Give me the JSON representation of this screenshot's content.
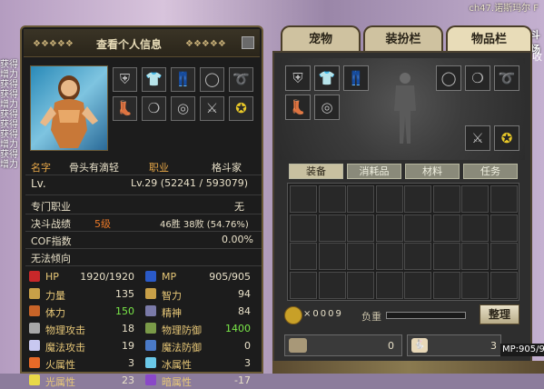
{
  "top": {
    "server_text": "ch47.诺斯玛尔 F"
  },
  "side_text": [
    "获得",
    "增力",
    "获得",
    "获得",
    "增力",
    "获得",
    "获得",
    "获得",
    "增力",
    "获得",
    "增力"
  ],
  "right_edge": {
    "top": "斗场",
    "mid": "收"
  },
  "info_panel": {
    "title": "查看个人信息",
    "equip_icons": [
      "shoulder-icon",
      "top-armor-icon",
      "pants-icon",
      "ring-icon",
      "belt-icon",
      "shoes-icon",
      "necklace-icon",
      "bracelet-icon",
      "weapon-icon",
      "title-medal-icon"
    ],
    "name_label": "名字",
    "name_value": "骨头有滴轻",
    "job_label": "职业",
    "job_value": "格斗家",
    "lv_label": "Lv.",
    "lv_value": "Lv.29 (52241 / 593079)",
    "spec_label": "专门职业",
    "spec_value": "无",
    "duel_label": "决斗战绩",
    "duel_rank": "5级",
    "duel_record": "46胜 38败 (54.76%)",
    "cof_label": "COF指数",
    "cof_value": "0.00%",
    "tendency_label": "无法倾向",
    "stats": [
      {
        "label": "HP",
        "value": "1920/1920",
        "color": "#c8282a",
        "icon": "heart-icon"
      },
      {
        "label": "MP",
        "value": "905/905",
        "color": "#2a5ac8",
        "icon": "mana-heart-icon"
      },
      {
        "label": "力量",
        "value": "135",
        "color": "#c8a048",
        "icon": "strength-icon"
      },
      {
        "label": "智力",
        "value": "94",
        "color": "#c8a048",
        "icon": "intelligence-icon"
      },
      {
        "label": "体力",
        "value": "150",
        "color": "#c86428",
        "icon": "vitality-icon",
        "buff": true
      },
      {
        "label": "精神",
        "value": "84",
        "color": "#7a7aa8",
        "icon": "spirit-icon"
      },
      {
        "label": "物理攻击",
        "value": "18",
        "color": "#a8a8a8",
        "icon": "sword-icon"
      },
      {
        "label": "物理防御",
        "value": "1400",
        "color": "#7a9a48",
        "icon": "shield-icon",
        "buff": true
      },
      {
        "label": "魔法攻击",
        "value": "19",
        "color": "#c8c8f0",
        "icon": "magic-attack-icon"
      },
      {
        "label": "魔法防御",
        "value": "0",
        "color": "#4a7ac8",
        "icon": "magic-defense-icon"
      },
      {
        "label": "火属性",
        "value": "3",
        "color": "#e86a28",
        "icon": "fire-icon"
      },
      {
        "label": "冰属性",
        "value": "3",
        "color": "#6ac8e8",
        "icon": "ice-icon"
      },
      {
        "label": "光属性",
        "value": "23",
        "color": "#e8d848",
        "icon": "light-icon"
      },
      {
        "label": "暗属性",
        "value": "-17",
        "color": "#8a48c8",
        "icon": "dark-icon"
      }
    ]
  },
  "tabs": {
    "pet": "宠物",
    "avatar": "装扮栏",
    "inventory": "物品栏"
  },
  "inventory": {
    "equip_icons": [
      "shoulder-icon",
      "top-armor-icon",
      "pants-icon",
      "ring-icon",
      "necklace-icon",
      "belt-icon",
      "shoes-icon",
      "bracelet-icon",
      "sword-icon",
      "title-medal-icon"
    ],
    "subtabs": [
      "装备",
      "消耗品",
      "材料",
      "任务"
    ],
    "gold": "×0009",
    "weight_label": "负重",
    "sort_button": "整理",
    "bottom_value1": "0",
    "bottom_value2": "3",
    "mp_readout": "MP:905/9"
  }
}
